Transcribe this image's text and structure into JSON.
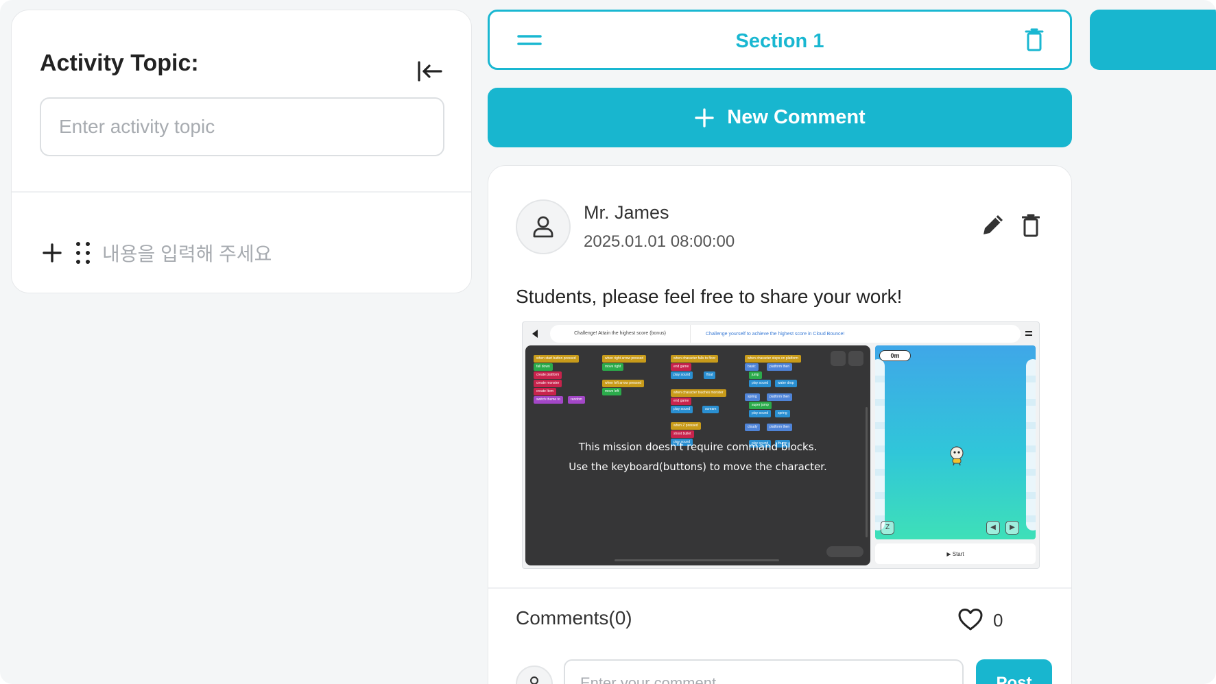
{
  "left_panel": {
    "topic_title": "Activity Topic:",
    "topic_placeholder": "Enter activity topic",
    "content_placeholder": "내용을 입력해 주세요"
  },
  "section": {
    "title": "Section 1"
  },
  "new_comment": {
    "label": "New Comment"
  },
  "post": {
    "author": "Mr. James",
    "date": "2025.01.01 08:00:00",
    "text": "Students, please feel free to share your work!",
    "screenshot": {
      "header_left": "Challenge! Attain the highest score (bonus)",
      "header_right": "Challenge yourself to achieve the highest score in Cloud Bounce!",
      "overlay_line1": "This mission doesn't require command blocks.",
      "overlay_line2": "Use the keyboard(buttons) to move the character.",
      "score": "0m",
      "start_label": "Start",
      "button_z": "Z",
      "blocks": [
        "when start button pressed",
        "fall down",
        "create platform",
        "create monster",
        "create Item",
        "switch theme to",
        "random",
        "when right arrow pressed",
        "move right",
        "when left arrow pressed",
        "move left",
        "when character falls to floor",
        "end game",
        "play sound",
        "float",
        "when character touches monster",
        "end game",
        "play sound",
        "scream",
        "when Z pressed",
        "shoot bullet",
        "play sound",
        "when character steps on platform",
        "basic",
        "platform then",
        "jump",
        "play sound",
        "water drop",
        "spring",
        "platform then",
        "super jump",
        "play sound",
        "spring",
        "cloudy",
        "platform then",
        "play sound",
        "thump"
      ]
    }
  },
  "comments": {
    "label": "Comments(0)",
    "like_count": "0",
    "input_placeholder": "Enter your comment",
    "post_label": "Post"
  },
  "colors": {
    "accent": "#18b6cf",
    "editor_bg": "#363637"
  },
  "icons": [
    "collapse-left-icon",
    "plus-icon",
    "drag-handle-icon",
    "menu-icon",
    "trash-icon",
    "user-icon",
    "pencil-icon",
    "heart-icon"
  ]
}
